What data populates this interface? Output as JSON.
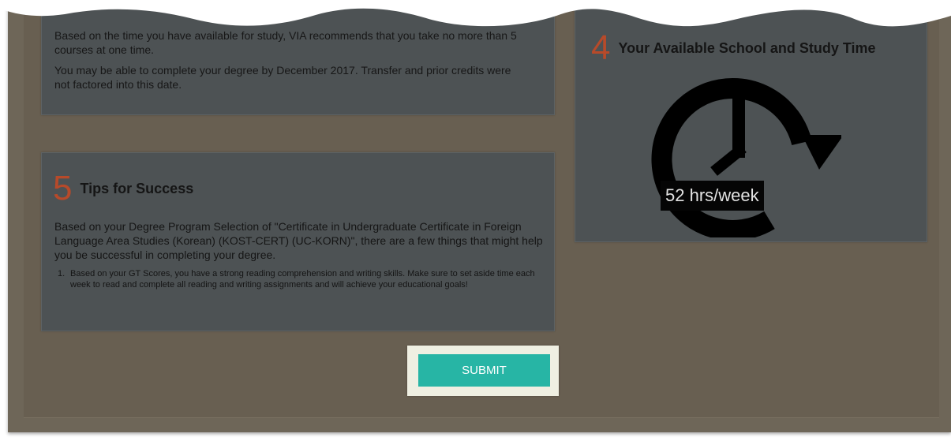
{
  "top_panel": {
    "recommendation": "Based on the time you have available for study, VIA recommends that you take no more than 5 courses at one time.",
    "completion": "You may be able to complete your degree by December 2017. Transfer and prior credits were not factored into this date."
  },
  "tips_section": {
    "number": "5",
    "title": "Tips for Success",
    "intro": "Based on your Degree Program Selection of \"Certificate in Undergraduate Certificate in Foreign Language Area Studies (Korean) (KOST-CERT) (UC-KORN)\", there are a few things that might help you be successful in completing your degree.",
    "items": [
      {
        "number": "1.",
        "text": "Based on your GT Scores, you have a strong reading comprehension and writing skills. Make sure to set aside time each week to read and complete all reading and writing assignments and will achieve your educational goals!"
      }
    ]
  },
  "time_section": {
    "number": "4",
    "title": "Your Available School and Study Time",
    "hours": "52 hrs/week"
  },
  "submit_label": "SUBMIT",
  "icons": {
    "clock": "clock-cycle-icon"
  },
  "colors": {
    "background": "#6e6658",
    "panel": "#4d5254",
    "accent_number": "#b74a2a",
    "submit_button": "#27b5a5",
    "submit_frame": "#efefe2"
  }
}
